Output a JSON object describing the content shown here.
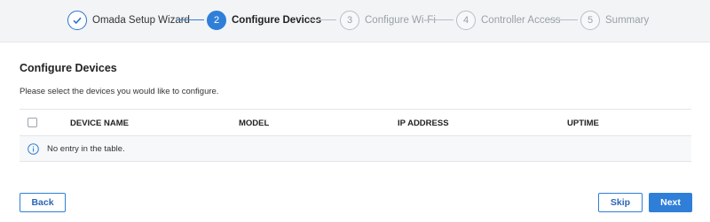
{
  "stepper": {
    "steps": [
      {
        "number": "",
        "label": "Omada Setup Wizard",
        "state": "done"
      },
      {
        "number": "2",
        "label": "Configure Devices",
        "state": "active"
      },
      {
        "number": "3",
        "label": "Configure Wi-Fi",
        "state": "pending"
      },
      {
        "number": "4",
        "label": "Controller Access",
        "state": "pending"
      },
      {
        "number": "5",
        "label": "Summary",
        "state": "pending"
      }
    ]
  },
  "page": {
    "title": "Configure Devices",
    "subtitle": "Please select the devices you would like to configure."
  },
  "table": {
    "columns": [
      "DEVICE NAME",
      "MODEL",
      "IP ADDRESS",
      "UPTIME"
    ],
    "empty_message": "No entry in the table."
  },
  "footer": {
    "back_label": "Back",
    "skip_label": "Skip",
    "next_label": "Next"
  },
  "colors": {
    "accent": "#2f7fd8",
    "stepper_bg": "#f3f4f6"
  }
}
